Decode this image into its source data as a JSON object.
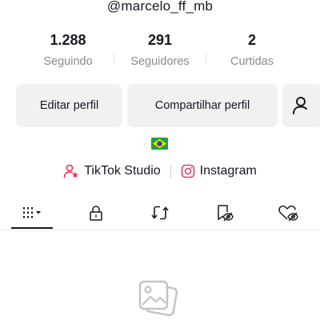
{
  "profile": {
    "username": "@marcelo_ff_mb",
    "country_flag": "brazil-flag"
  },
  "stats": [
    {
      "value": "1.288",
      "label": "Seguindo"
    },
    {
      "value": "291",
      "label": "Seguidores"
    },
    {
      "value": "2",
      "label": "Curtidas"
    }
  ],
  "actions": {
    "edit_label": "Editar perfil",
    "share_label": "Compartilhar perfil",
    "add_friends_icon": "add-friend-icon"
  },
  "links": {
    "studio_label": "TikTok Studio",
    "instagram_label": "Instagram"
  },
  "tabs": [
    {
      "icon": "grid-icon",
      "selected": true
    },
    {
      "icon": "lock-icon",
      "selected": false
    },
    {
      "icon": "repost-icon",
      "selected": false
    },
    {
      "icon": "favorites-icon",
      "selected": false
    },
    {
      "icon": "liked-icon",
      "selected": false
    }
  ],
  "colors": {
    "accent_pink": "#fe2c55",
    "text_primary": "#161823",
    "text_secondary": "#8a8b91",
    "button_bg": "#f1f1f2"
  }
}
